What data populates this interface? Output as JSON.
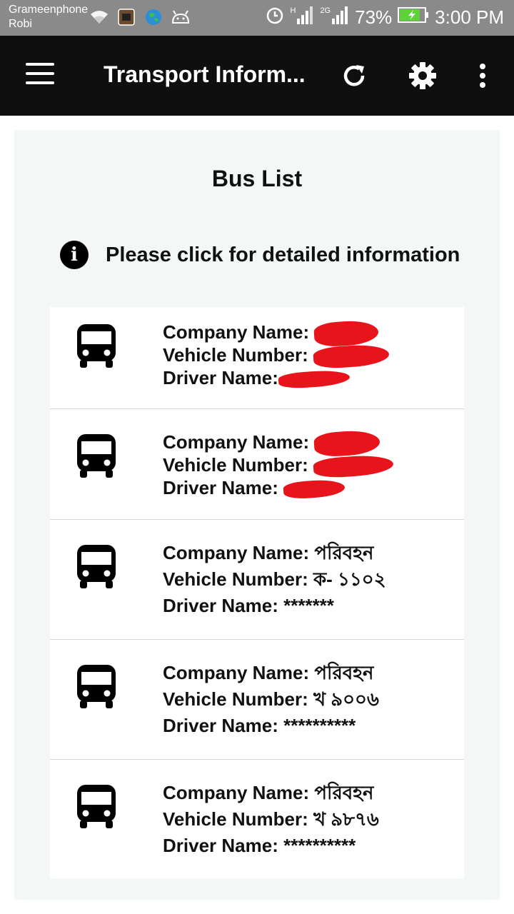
{
  "status_bar": {
    "carrier_line1": "Grameenphone",
    "carrier_line2": "Robi",
    "battery_percent": "73%",
    "time": "3:00 PM",
    "network_tag_1": "H",
    "network_tag_2": "2G",
    "icons": [
      "wifi-icon",
      "app-notification-icon",
      "globe-icon",
      "android-icon",
      "alarm-icon",
      "signal-icon",
      "signal-icon",
      "battery-charging-icon"
    ]
  },
  "app_bar": {
    "title": "Transport Inform...",
    "icons": [
      "menu-icon",
      "refresh-icon",
      "settings-gear-icon",
      "overflow-menu-icon"
    ]
  },
  "main": {
    "list_title": "Bus List",
    "info_icon_glyph": "i",
    "info_text": "Please click for detailed information",
    "labels": {
      "company": "Company Name:",
      "vehicle": "Vehicle Number:",
      "driver": "Driver Name:"
    },
    "buses": [
      {
        "company": "",
        "vehicle": "",
        "driver": "",
        "redacted": true
      },
      {
        "company": "",
        "vehicle": "",
        "driver": "",
        "redacted": true
      },
      {
        "company": "পরিবহন",
        "vehicle": "ক- ১১০২",
        "driver": "*******"
      },
      {
        "company": "পরিবহন",
        "vehicle": "খ ৯০০৬",
        "driver": "**********"
      },
      {
        "company": "পরিবহন",
        "vehicle": "খ ৯৮৭৬",
        "driver": "**********"
      }
    ]
  },
  "colors": {
    "status_bar": "#8a8a8a",
    "app_bar": "#0f0f0f",
    "content_card": "#f3f7f5",
    "redaction": "#e8141c"
  }
}
